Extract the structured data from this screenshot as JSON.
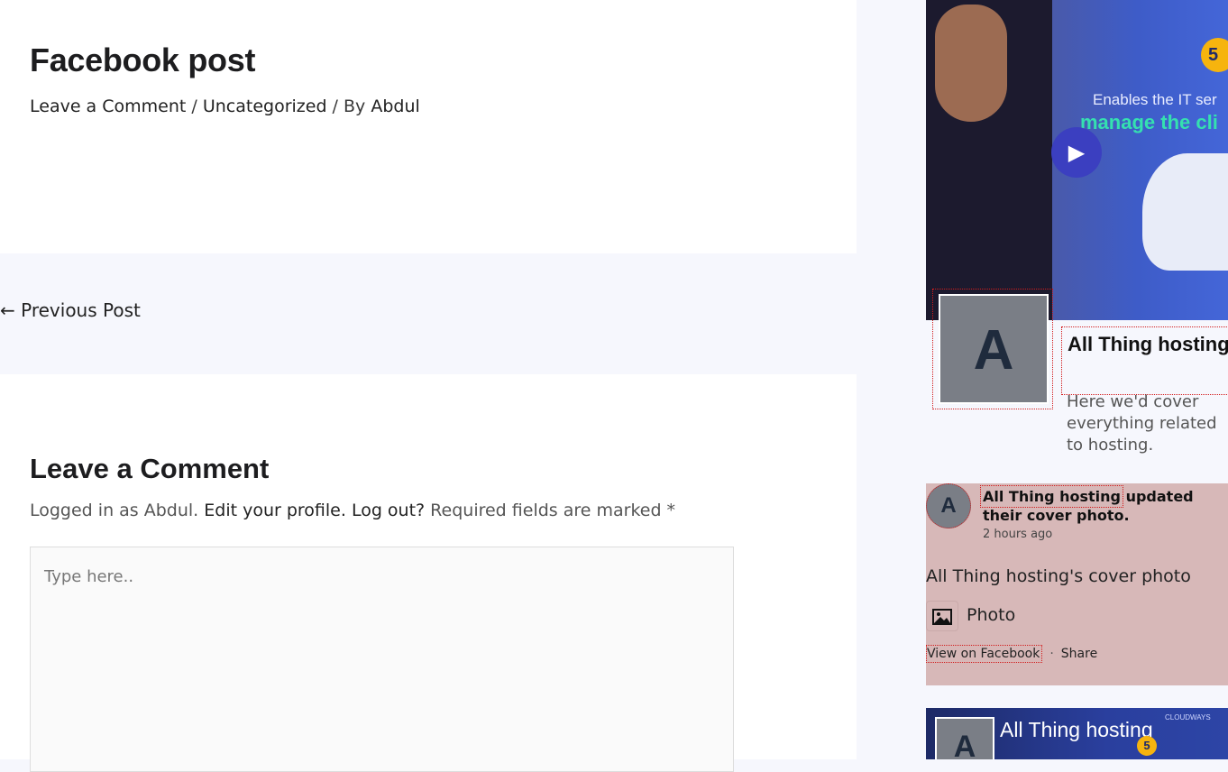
{
  "post": {
    "title": "Facebook post",
    "meta_comment": "Leave a Comment",
    "meta_sep1": " / ",
    "meta_category": "Uncategorized",
    "meta_by": " / By ",
    "meta_author": "Abdul"
  },
  "navigation": {
    "previous_arrow": "←",
    "previous_label": "Previous Post"
  },
  "comments": {
    "title": "Leave a Comment",
    "logged_in_prefix": "Logged in as Abdul. ",
    "edit_profile": "Edit your profile.",
    "log_out": "Log out?",
    "required_text": " Required fields are marked *",
    "textarea_placeholder": "Type here.."
  },
  "facebook_widget": {
    "cover": {
      "badge": "5",
      "line1": "Enables the IT ser",
      "line2": "manage the cli"
    },
    "avatar_letter": "A",
    "page_name": "All Thing hosting",
    "page_description": "Here we'd cover everything related to hosting.",
    "feed": {
      "author": "All Thing hosting",
      "action": " updated their cover photo.",
      "time": "2 hours ago",
      "text": "All Thing hosting's cover photo",
      "photo_label": "Photo",
      "view_on_facebook": "View on Facebook",
      "separator": "·",
      "share": "Share"
    },
    "video_card": {
      "title": "All Thing hosting",
      "badge": "5",
      "logo": "CLOUDWAYS"
    }
  },
  "colors": {
    "page_background": "#f6f7fd",
    "feed_highlight": "#d7b8b8",
    "avatar_gray": "#7a7e86",
    "debug_outline": "#d21c1c"
  }
}
